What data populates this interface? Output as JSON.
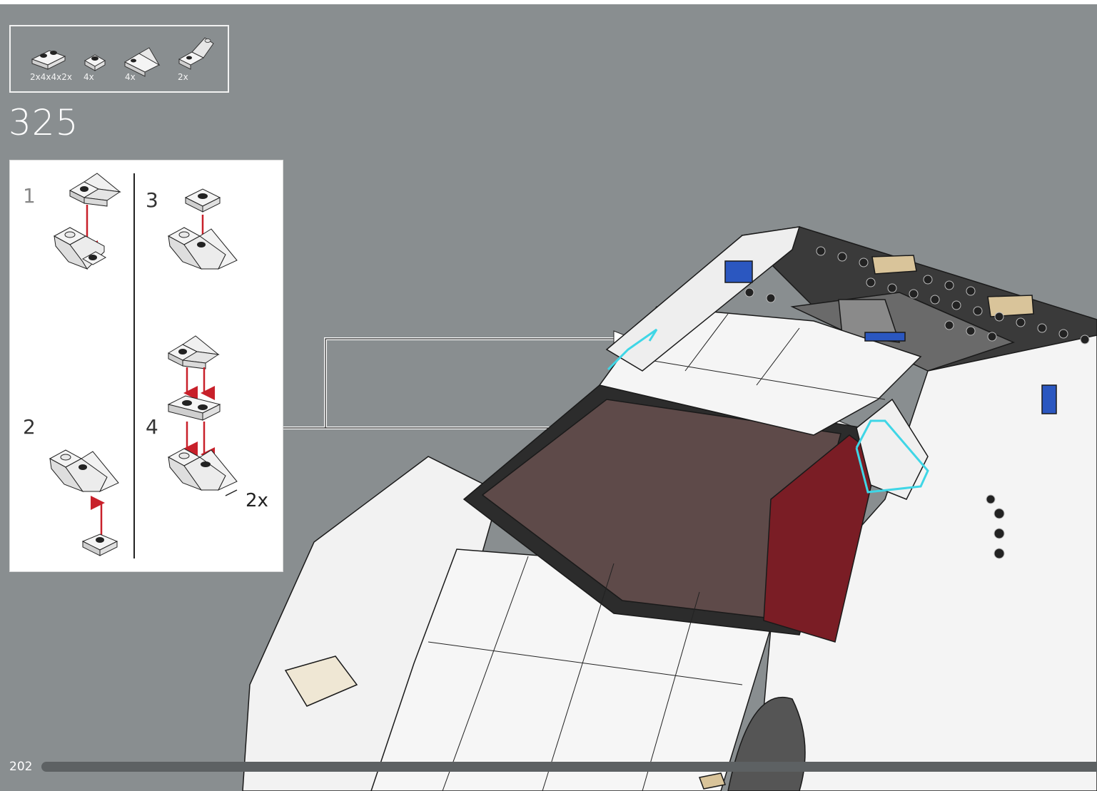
{
  "step": {
    "number": "325"
  },
  "parts_list": [
    {
      "qty": "2x4x4x2x",
      "name": "plate-1x2-icon"
    },
    {
      "qty": "4x",
      "name": "round-plate-icon"
    },
    {
      "qty": "4x",
      "name": "slope-plate-icon"
    },
    {
      "qty": "2x",
      "name": "inverted-slope-icon"
    }
  ],
  "subassembly": {
    "steps": [
      "1",
      "2",
      "3",
      "4"
    ],
    "multiplier": "2x"
  },
  "footer": {
    "page_number": "202"
  },
  "colors": {
    "background": "#898e90",
    "arrow_red": "#c8202a",
    "highlight_cyan": "#3fd6e6",
    "seat_red": "#7a1d25"
  }
}
